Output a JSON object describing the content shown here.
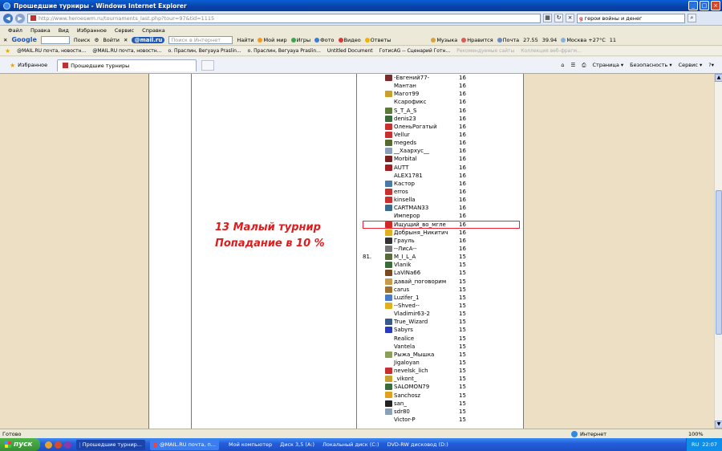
{
  "window": {
    "title": "Прошедшие турниры - Windows Internet Explorer"
  },
  "address": {
    "url": "http://www.heroeswm.ru/tournaments_last.php?tour=97&tid=1115",
    "search_value": "герои войны и денег"
  },
  "menu": [
    "Файл",
    "Правка",
    "Вид",
    "Избранное",
    "Сервис",
    "Справка"
  ],
  "toolbar": {
    "google": "Google",
    "search_label": "Поиск",
    "login": "Войти",
    "mailru": "@mail.ru",
    "search_placeholder": "Поиск в Интернет",
    "find": "Найти",
    "moi_mir": "Мой мир",
    "games": "Игры",
    "photo": "Фото",
    "video": "Видео",
    "answers": "Ответы",
    "music": "Музыка",
    "likes": "Нравится",
    "mail": "Почта",
    "rate1": "27.55",
    "rate2": "39.94",
    "weather": "Москва +27°C",
    "count": "11"
  },
  "favorites": [
    "@MAIL.RU почта, новостн...",
    "@MAIL.RU почта, новостн...",
    "о. Праслин, Вегуaya Praslin...",
    "о. Праслин, Вегуaya Praslin...",
    "Untitled Document",
    "ГотисАG -- Сценарий Готн...",
    "Рекомендуемые сайты",
    "Коллекция веб-фрагм..."
  ],
  "tabs": {
    "favorites": "Избранное",
    "active": "Прошедшие турниры",
    "page": "Страница",
    "safety": "Безопасность",
    "tools": "Сервис"
  },
  "banner": {
    "line1": "13 Малый турнир",
    "line2": "Попадание в 10 %"
  },
  "players": [
    {
      "rank": "",
      "nick": "-Евгений77-",
      "score": "16",
      "color": "#7a2b2b"
    },
    {
      "rank": "",
      "nick": "Мантан",
      "score": "16",
      "color": "#ffffff"
    },
    {
      "rank": "",
      "nick": "Магот99",
      "score": "16",
      "color": "#c9a02a"
    },
    {
      "rank": "",
      "nick": "Ксарофикс",
      "score": "16",
      "color": "#ffffff"
    },
    {
      "rank": "",
      "nick": "S_T_A_S",
      "score": "16",
      "color": "#5d7a3a"
    },
    {
      "rank": "",
      "nick": "denis23",
      "score": "16",
      "color": "#3a6b3a"
    },
    {
      "rank": "",
      "nick": "ОленьРогатый",
      "score": "16",
      "color": "#c83030"
    },
    {
      "rank": "",
      "nick": "Vellur",
      "score": "16",
      "color": "#c83030"
    },
    {
      "rank": "",
      "nick": "megeds",
      "score": "16",
      "color": "#556b2f"
    },
    {
      "rank": "",
      "nick": "__Хаархус__",
      "score": "16",
      "color": "#8aa0b8"
    },
    {
      "rank": "",
      "nick": "Morbital",
      "score": "16",
      "color": "#7a1f1f"
    },
    {
      "rank": "",
      "nick": "AUTT",
      "score": "16",
      "color": "#a02020"
    },
    {
      "rank": "",
      "nick": "ALEX1781",
      "score": "16",
      "color": "#ffffff"
    },
    {
      "rank": "",
      "nick": "Кастор",
      "score": "16",
      "color": "#4a7aa8"
    },
    {
      "rank": "",
      "nick": "erros",
      "score": "16",
      "color": "#c83030"
    },
    {
      "rank": "",
      "nick": "kinsella",
      "score": "16",
      "color": "#c83030"
    },
    {
      "rank": "",
      "nick": "CARTMAN33",
      "score": "16",
      "color": "#3a6b8a"
    },
    {
      "rank": "",
      "nick": "Имперор",
      "score": "16",
      "color": "#ffffff"
    },
    {
      "rank": "",
      "nick": "Ищущий_во_мгле",
      "score": "16",
      "color": "#d02828"
    },
    {
      "rank": "",
      "nick": "Добрыня_Никитич",
      "score": "16",
      "color": "#e0b020"
    },
    {
      "rank": "",
      "nick": "Грауль",
      "score": "16",
      "color": "#333333"
    },
    {
      "rank": "",
      "nick": "--ЛисА--",
      "score": "16",
      "color": "#777777"
    },
    {
      "rank": "81.",
      "nick": "M_I_L_A",
      "score": "15",
      "color": "#5a6a3a"
    },
    {
      "rank": "",
      "nick": "Vlanik",
      "score": "15",
      "color": "#3a6b3a"
    },
    {
      "rank": "",
      "nick": "LaViNa66",
      "score": "15",
      "color": "#7a4a1f"
    },
    {
      "rank": "",
      "nick": "давай_поговорим",
      "score": "15",
      "color": "#c89a4a"
    },
    {
      "rank": "",
      "nick": "carus",
      "score": "15",
      "color": "#a07030"
    },
    {
      "rank": "",
      "nick": "Luzifer_1",
      "score": "15",
      "color": "#4a7ac8"
    },
    {
      "rank": "",
      "nick": "--Shved--",
      "score": "15",
      "color": "#e0b020"
    },
    {
      "rank": "",
      "nick": "Vladimir63-2",
      "score": "15",
      "color": "#ffffff"
    },
    {
      "rank": "",
      "nick": "True_Wizard",
      "score": "15",
      "color": "#3a5a8a"
    },
    {
      "rank": "",
      "nick": "Sabyrs",
      "score": "15",
      "color": "#2a3ab8"
    },
    {
      "rank": "",
      "nick": "Realice",
      "score": "15",
      "color": "#ffffff"
    },
    {
      "rank": "",
      "nick": "Vantela",
      "score": "15",
      "color": "#ffffff"
    },
    {
      "rank": "",
      "nick": "Рыжа_Мышка",
      "score": "15",
      "color": "#8aa05a"
    },
    {
      "rank": "",
      "nick": "Jigaloyan",
      "score": "15",
      "color": "#ffffff"
    },
    {
      "rank": "",
      "nick": "nevelsk_lich",
      "score": "15",
      "color": "#c83030"
    },
    {
      "rank": "",
      "nick": "_vikont_",
      "score": "15",
      "color": "#c8a030"
    },
    {
      "rank": "",
      "nick": "SALOMON79",
      "score": "15",
      "color": "#3a6b3a"
    },
    {
      "rank": "",
      "nick": "Sanchosz",
      "score": "15",
      "color": "#e0a020"
    },
    {
      "rank": "",
      "nick": "san_",
      "score": "15",
      "color": "#222222"
    },
    {
      "rank": "",
      "nick": "sdr80",
      "score": "15",
      "color": "#8aa0b8"
    },
    {
      "rank": "",
      "nick": "Victor-P",
      "score": "15",
      "color": "#ffffff"
    }
  ],
  "status": {
    "left": "Готово",
    "zone": "Интернет",
    "zoom": "100%"
  },
  "taskbar": {
    "start": "пуск",
    "task1": "Прошедшие турнир...",
    "task2": "@MAIL.RU почта, п...",
    "tray1": "Мой компьютер",
    "tray2": "Диск 3,5 (A:)",
    "tray3": "Локальный диск (C:)",
    "tray4": "DVD-RW дисковод (D:)",
    "lang": "RU",
    "clock": "22:07"
  }
}
